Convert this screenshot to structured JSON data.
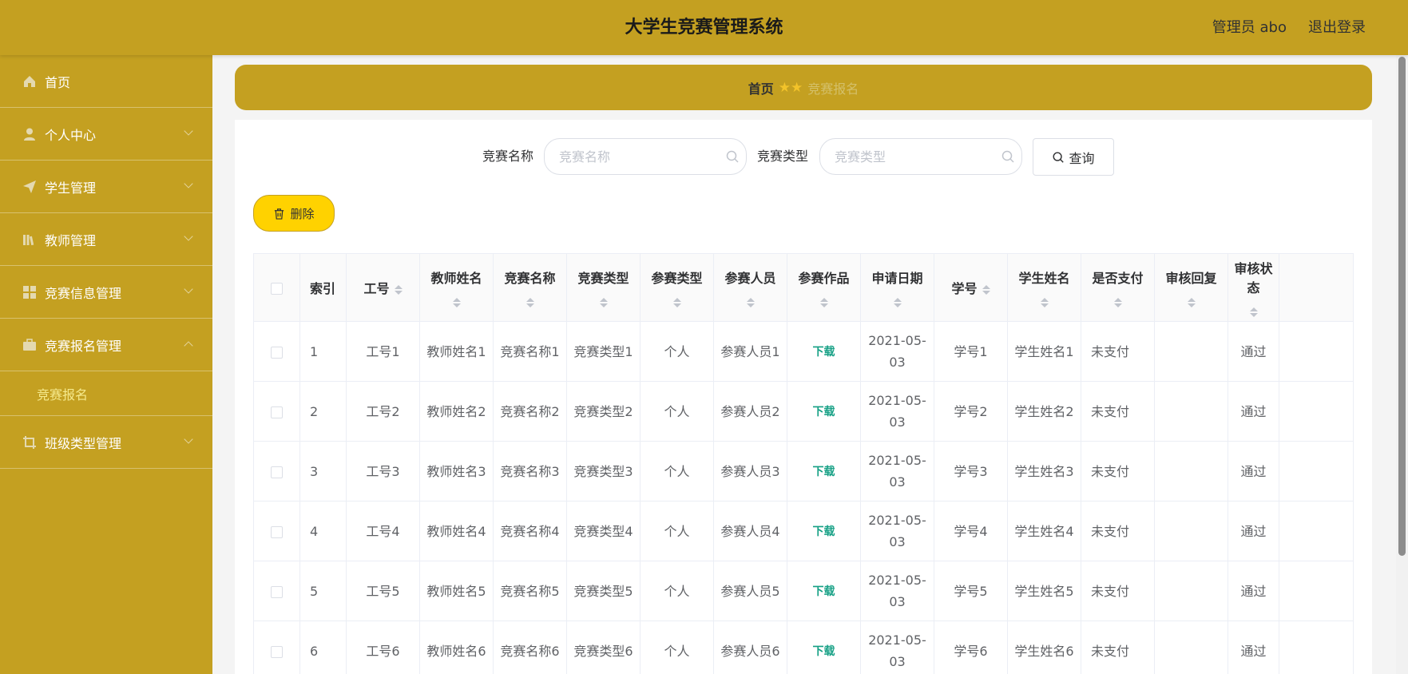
{
  "header": {
    "title": "大学生竞赛管理系统",
    "user": "管理员 abo",
    "logout": "退出登录"
  },
  "sidebar": {
    "items": [
      {
        "label": "首页",
        "icon": "home-icon",
        "expandable": false
      },
      {
        "label": "个人中心",
        "icon": "user-icon",
        "expandable": true
      },
      {
        "label": "学生管理",
        "icon": "send-icon",
        "expandable": true
      },
      {
        "label": "教师管理",
        "icon": "library-icon",
        "expandable": true
      },
      {
        "label": "竞赛信息管理",
        "icon": "grid-icon",
        "expandable": true
      },
      {
        "label": "竞赛报名管理",
        "icon": "briefcase-icon",
        "expandable": true,
        "expanded": true,
        "children": [
          "竞赛报名"
        ]
      },
      {
        "label": "班级类型管理",
        "icon": "crop-icon",
        "expandable": true
      }
    ]
  },
  "breadcrumb": {
    "home": "首页",
    "separator": "★★",
    "current": "竞赛报名"
  },
  "search": {
    "name_label": "竞赛名称",
    "name_placeholder": "竞赛名称",
    "type_label": "竞赛类型",
    "type_placeholder": "竞赛类型",
    "query_label": "查询"
  },
  "actions": {
    "delete_label": "删除"
  },
  "table": {
    "columns": [
      "索引",
      "工号",
      "教师姓名",
      "竞赛名称",
      "竞赛类型",
      "参赛类型",
      "参赛人员",
      "参赛作品",
      "申请日期",
      "学号",
      "学生姓名",
      "是否支付",
      "审核回复",
      "审核状态"
    ],
    "rows": [
      {
        "index": "1",
        "gonghao": "工号1",
        "teacher": "教师姓名1",
        "comp_name": "竞赛名称1",
        "comp_type": "竞赛类型1",
        "part_type": "个人",
        "members": "参赛人员1",
        "work": "下载",
        "date": "2021-05-03",
        "xuehao": "学号1",
        "student": "学生姓名1",
        "paid": "未支付",
        "reply": "",
        "status": "通过"
      },
      {
        "index": "2",
        "gonghao": "工号2",
        "teacher": "教师姓名2",
        "comp_name": "竞赛名称2",
        "comp_type": "竞赛类型2",
        "part_type": "个人",
        "members": "参赛人员2",
        "work": "下载",
        "date": "2021-05-03",
        "xuehao": "学号2",
        "student": "学生姓名2",
        "paid": "未支付",
        "reply": "",
        "status": "通过"
      },
      {
        "index": "3",
        "gonghao": "工号3",
        "teacher": "教师姓名3",
        "comp_name": "竞赛名称3",
        "comp_type": "竞赛类型3",
        "part_type": "个人",
        "members": "参赛人员3",
        "work": "下载",
        "date": "2021-05-03",
        "xuehao": "学号3",
        "student": "学生姓名3",
        "paid": "未支付",
        "reply": "",
        "status": "通过"
      },
      {
        "index": "4",
        "gonghao": "工号4",
        "teacher": "教师姓名4",
        "comp_name": "竞赛名称4",
        "comp_type": "竞赛类型4",
        "part_type": "个人",
        "members": "参赛人员4",
        "work": "下载",
        "date": "2021-05-03",
        "xuehao": "学号4",
        "student": "学生姓名4",
        "paid": "未支付",
        "reply": "",
        "status": "通过"
      },
      {
        "index": "5",
        "gonghao": "工号5",
        "teacher": "教师姓名5",
        "comp_name": "竞赛名称5",
        "comp_type": "竞赛类型5",
        "part_type": "个人",
        "members": "参赛人员5",
        "work": "下载",
        "date": "2021-05-03",
        "xuehao": "学号5",
        "student": "学生姓名5",
        "paid": "未支付",
        "reply": "",
        "status": "通过"
      },
      {
        "index": "6",
        "gonghao": "工号6",
        "teacher": "教师姓名6",
        "comp_name": "竞赛名称6",
        "comp_type": "竞赛类型6",
        "part_type": "个人",
        "members": "参赛人员6",
        "work": "下载",
        "date": "2021-05-03",
        "xuehao": "学号6",
        "student": "学生姓名6",
        "paid": "未支付",
        "reply": "",
        "status": "通过"
      }
    ]
  },
  "colors": {
    "theme": "#c4a021",
    "delete_button": "#ffd200",
    "download_link": "#16a085",
    "active_submenu": "#f5e98c"
  }
}
